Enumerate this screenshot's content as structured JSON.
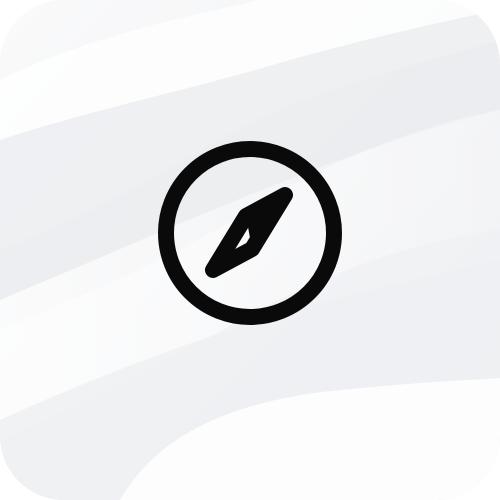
{
  "app_icon": {
    "icon": "compass-icon",
    "glyph_color": "#0a0a0a",
    "background_color": "#f3f4f6",
    "wave_colors": [
      "#ffffff",
      "#e9eaed",
      "#f7f8f9"
    ]
  }
}
